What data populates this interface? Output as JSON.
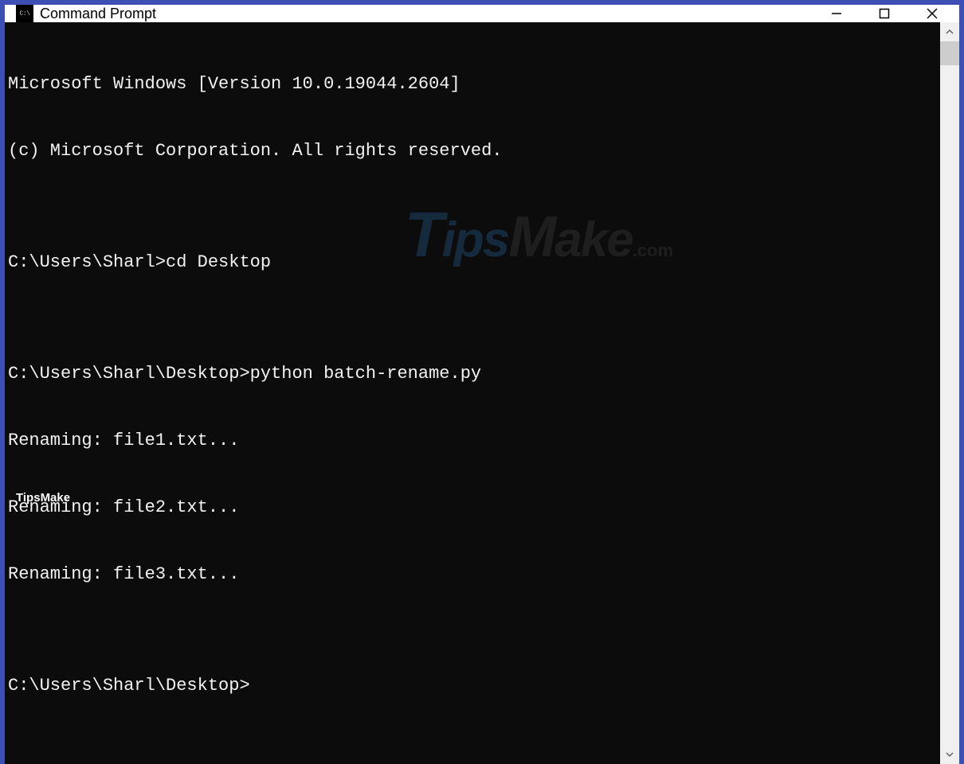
{
  "window": {
    "title": "Command Prompt"
  },
  "terminal": {
    "lines": [
      "Microsoft Windows [Version 10.0.19044.2604]",
      "(c) Microsoft Corporation. All rights reserved.",
      "",
      "C:\\Users\\Sharl>cd Desktop",
      "",
      "C:\\Users\\Sharl\\Desktop>python batch-rename.py",
      "Renaming: file1.txt...",
      "Renaming: file2.txt...",
      "Renaming: file3.txt...",
      "",
      "C:\\Users\\Sharl\\Desktop>"
    ]
  },
  "watermark": {
    "t": "T",
    "ips": "ips",
    "m": "M",
    "ake": "ake",
    "com": ".com"
  },
  "footer": {
    "label": "TipsMake"
  }
}
